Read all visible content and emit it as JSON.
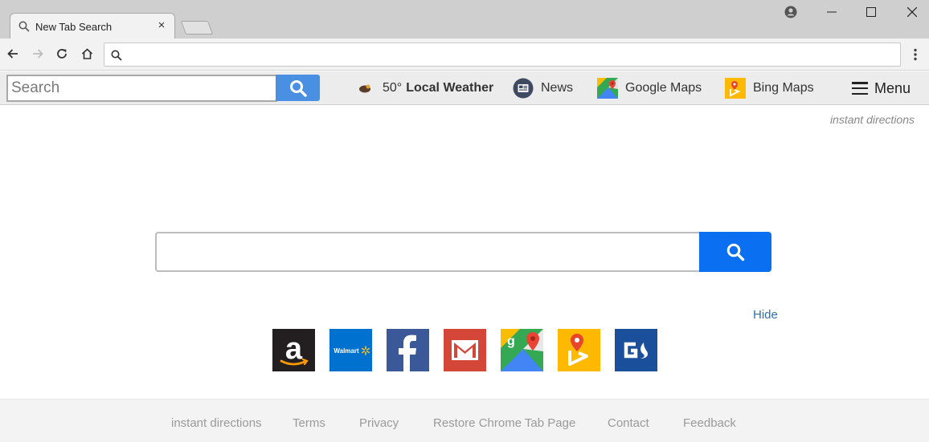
{
  "browser": {
    "tab_title": "New Tab Search",
    "tab_close": "×"
  },
  "omnibox": {
    "value": "",
    "placeholder": ""
  },
  "extbar": {
    "search_placeholder": "Search",
    "weather_temp": "50°",
    "weather_label": "Local Weather",
    "news_label": "News",
    "google_maps_label": "Google Maps",
    "bing_maps_label": "Bing Maps",
    "menu_label": "Menu"
  },
  "main": {
    "top_link": "instant directions",
    "search_placeholder": "",
    "hide_label": "Hide",
    "tiles": [
      {
        "name": "amazon",
        "color": "#231f20"
      },
      {
        "name": "walmart",
        "label": "Walmart",
        "color": "#0071ce"
      },
      {
        "name": "facebook",
        "color": "#3b5998"
      },
      {
        "name": "gmail",
        "color": "#d44638"
      },
      {
        "name": "google-maps",
        "color": "#4caf50"
      },
      {
        "name": "bing-maps",
        "color": "#ffb900"
      },
      {
        "name": "gs",
        "color": "#1a4f9c"
      }
    ]
  },
  "footer": {
    "links": [
      "instant directions",
      "Terms",
      "Privacy",
      "Restore Chrome Tab Page",
      "Contact",
      "Feedback"
    ]
  },
  "colors": {
    "accent_blue": "#0a6ff0",
    "ext_button_blue": "#4a90e2",
    "link_blue": "#2f6fad"
  }
}
